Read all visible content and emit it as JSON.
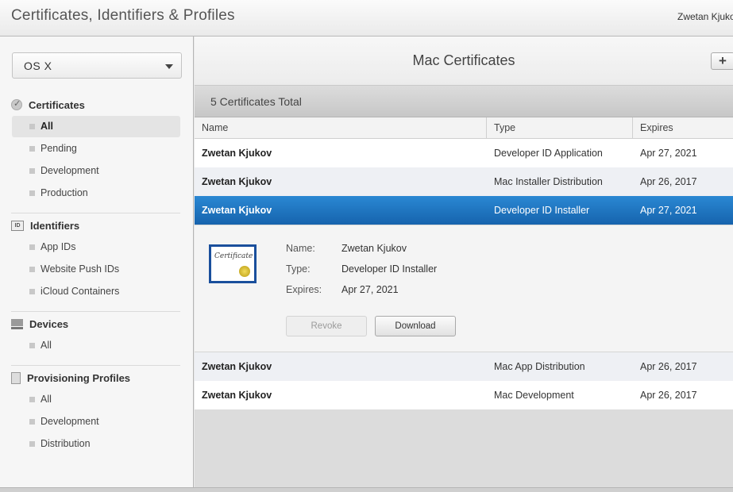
{
  "header": {
    "app_title": "Certificates, Identifiers & Profiles",
    "user_name": "Zwetan Kjukov"
  },
  "sidebar": {
    "platform": "OS X",
    "sections": [
      {
        "label": "Certificates",
        "icon": "certificate-icon",
        "items": [
          {
            "label": "All",
            "selected": true
          },
          {
            "label": "Pending"
          },
          {
            "label": "Development"
          },
          {
            "label": "Production"
          }
        ]
      },
      {
        "label": "Identifiers",
        "icon": "id-icon",
        "items": [
          {
            "label": "App IDs"
          },
          {
            "label": "Website Push IDs"
          },
          {
            "label": "iCloud Containers"
          }
        ]
      },
      {
        "label": "Devices",
        "icon": "device-icon",
        "items": [
          {
            "label": "All"
          }
        ]
      },
      {
        "label": "Provisioning Profiles",
        "icon": "profile-icon",
        "items": [
          {
            "label": "All"
          },
          {
            "label": "Development"
          },
          {
            "label": "Distribution"
          }
        ]
      }
    ]
  },
  "main": {
    "title": "Mac Certificates",
    "add_label": "+",
    "total": "5 Certificates Total",
    "columns": [
      "Name",
      "Type",
      "Expires"
    ],
    "rows": [
      {
        "name": "Zwetan Kjukov",
        "type": "Developer ID Application",
        "expires": "Apr 27, 2021"
      },
      {
        "name": "Zwetan Kjukov",
        "type": "Mac Installer Distribution",
        "expires": "Apr 26, 2017"
      },
      {
        "name": "Zwetan Kjukov",
        "type": "Developer ID Installer",
        "expires": "Apr 27, 2021",
        "selected": true
      },
      {
        "name": "Zwetan Kjukov",
        "type": "Mac App Distribution",
        "expires": "Apr 26, 2017"
      },
      {
        "name": "Zwetan Kjukov",
        "type": "Mac Development",
        "expires": "Apr 26, 2017"
      }
    ],
    "detail": {
      "cert_image_text": "Certificate",
      "name_label": "Name:",
      "name_value": "Zwetan Kjukov",
      "type_label": "Type:",
      "type_value": "Developer ID Installer",
      "expires_label": "Expires:",
      "expires_value": "Apr 27, 2021",
      "revoke_label": "Revoke",
      "download_label": "Download"
    }
  },
  "colors": {
    "selection": "#1f74c0",
    "sidebar_bg": "#f6f6f6",
    "stripe": "#eef0f4"
  }
}
